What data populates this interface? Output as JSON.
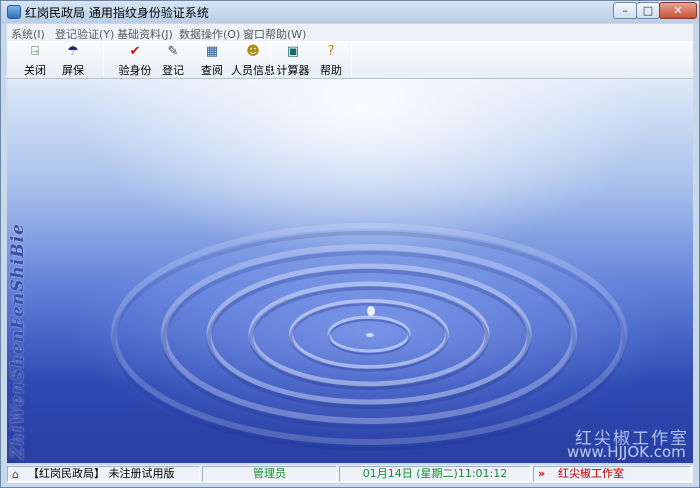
{
  "window": {
    "title": "红岗民政局  通用指纹身份验证系统",
    "controls": {
      "minimize": "–",
      "maximize": "□",
      "close": "✕"
    }
  },
  "menu": [
    "系统(I)",
    "登记验证(Y)",
    "基础资料(J)",
    "数据操作(O)",
    "窗口帮助(W)"
  ],
  "toolbar": [
    {
      "label": "关闭",
      "icon": "exit-door-icon",
      "glyph": "⍈",
      "color": "#2a7a2a"
    },
    {
      "label": "屏保",
      "icon": "umbrella-icon",
      "glyph": "☂",
      "color": "#1a2a6a"
    },
    {
      "label": "验身份",
      "icon": "checkmark-icon",
      "glyph": "✔",
      "color": "#d01010"
    },
    {
      "label": "登记",
      "icon": "pencil-icon",
      "glyph": "✎",
      "color": "#404040"
    },
    {
      "label": "查阅",
      "icon": "lookup-grid-icon",
      "glyph": "▦",
      "color": "#2a5a8a"
    },
    {
      "label": "人员信息",
      "icon": "people-icon",
      "glyph": "☻",
      "color": "#b08a10"
    },
    {
      "label": "计算器",
      "icon": "calculator-icon",
      "glyph": "▣",
      "color": "#1a6a6a"
    },
    {
      "label": "帮助",
      "icon": "help-icon",
      "glyph": "?",
      "color": "#b08a10"
    }
  ],
  "canvas": {
    "side_text": "ZhiWenShenFenShiBie",
    "watermark_cn": "红尖椒工作室",
    "watermark_url": "www.HJJOK.com"
  },
  "status": {
    "org": "【红岗民政局】 未注册试用版",
    "user": "管理员",
    "datetime": "01月14日 (星期二)11:01:12",
    "studio": "红尖椒工作室"
  }
}
